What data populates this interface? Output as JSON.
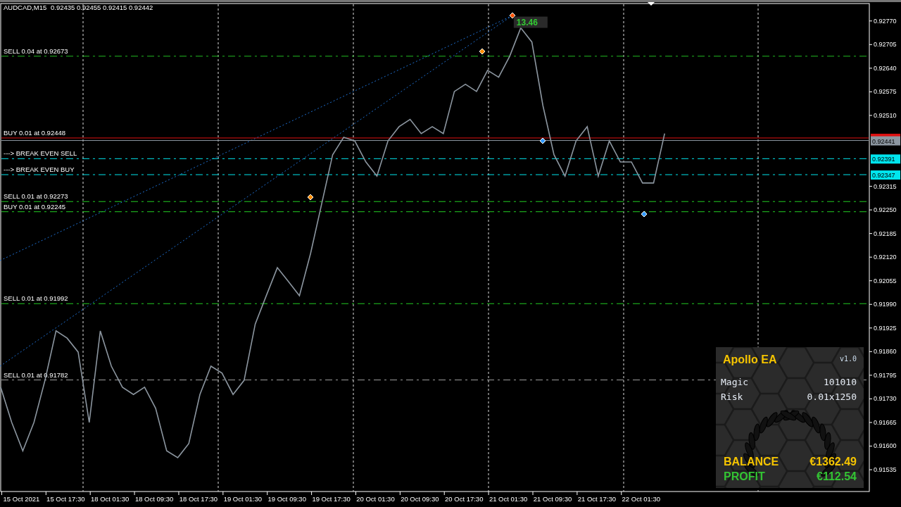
{
  "chart": {
    "quote": "0.92435 0.92455 0.92415 0.92442",
    "chart_data": {
      "type": "line",
      "title": "AUDCAD,M15",
      "grid": true,
      "categories": [
        null,
        null,
        "15 Oct 2021",
        null,
        null,
        null,
        "15 Oct 17:30",
        null,
        null,
        null,
        "18 Oct 01:30",
        null,
        null,
        null,
        "18 Oct 09:30",
        null,
        null,
        null,
        "18 Oct 17:30",
        null,
        null,
        null,
        "19 Oct 01:30",
        null,
        null,
        null,
        "19 Oct 09:30",
        null,
        null,
        null,
        "19 Oct 17:30",
        null,
        null,
        null,
        "20 Oct 01:30",
        null,
        null,
        null,
        "20 Oct 09:30",
        null,
        null,
        null,
        "20 Oct 17:30",
        null,
        null,
        null,
        "21 Oct 01:30",
        null,
        null,
        null,
        "21 Oct 09:30",
        null,
        null,
        null,
        "21 Oct 17:30",
        null,
        null,
        null,
        "22 Oct 01:30",
        null,
        null,
        null,
        null,
        null,
        null,
        null,
        null,
        null,
        null,
        null,
        null,
        null,
        null,
        null,
        null,
        null,
        null,
        null,
        null
      ],
      "series": [
        {
          "color": "#8c96a0",
          "values": [
            0.91762,
            0.91665,
            0.91587,
            0.91665,
            0.91781,
            0.91917,
            0.91897,
            0.91859,
            0.91665,
            0.91917,
            0.9182,
            0.91762,
            0.91742,
            0.91762,
            0.91704,
            0.91587,
            0.91568,
            0.91607,
            0.91742,
            0.9182,
            0.91801,
            0.91742,
            0.91781,
            0.91936,
            0.92014,
            0.92091,
            0.92053,
            0.92014,
            0.9213,
            0.92266,
            0.92402,
            0.9245,
            0.9244,
            0.92382,
            0.92343,
            0.9244,
            0.92479,
            0.92499,
            0.9246,
            0.92479,
            0.9246,
            0.92576,
            0.92596,
            0.92576,
            0.92634,
            0.92615,
            0.92673,
            0.92751,
            0.92712,
            0.92537,
            0.92402,
            0.92343,
            0.9244,
            0.92479,
            0.92343,
            0.9244,
            0.92382,
            0.92382,
            0.92324,
            0.92324,
            0.9246,
            null,
            null,
            null,
            null,
            null,
            null,
            null,
            null,
            null,
            null,
            null,
            null,
            null,
            null,
            null,
            null,
            null,
            null
          ]
        }
      ],
      "ylim": [
        0.91475,
        0.92818
      ],
      "yticks": [
        {
          "value": 0.9277,
          "label": "0.92770"
        },
        {
          "value": 0.92705,
          "label": "0.92705"
        },
        {
          "value": 0.9264,
          "label": "0.92640"
        },
        {
          "value": 0.92575,
          "label": "0.92575"
        },
        {
          "value": 0.9251,
          "label": "0.92510"
        },
        {
          "value": 0.92315,
          "label": "0.92315"
        },
        {
          "value": 0.9225,
          "label": "0.92250"
        },
        {
          "value": 0.92185,
          "label": "0.92185"
        },
        {
          "value": 0.9212,
          "label": "0.92120"
        },
        {
          "value": 0.92055,
          "label": "0.92055"
        },
        {
          "value": 0.9199,
          "label": "0.91990"
        },
        {
          "value": 0.91925,
          "label": "0.91925"
        },
        {
          "value": 0.9186,
          "label": "0.91860"
        },
        {
          "value": 0.91795,
          "label": "0.91795"
        },
        {
          "value": 0.9173,
          "label": "0.91730"
        },
        {
          "value": 0.91665,
          "label": "0.91665"
        },
        {
          "value": 0.916,
          "label": "0.91600"
        },
        {
          "value": 0.91535,
          "label": "0.91535"
        }
      ],
      "ref_lines": [
        {
          "axis": "y",
          "value": 0.92673,
          "label": "SELL 0.04 at 0.92673",
          "color": "#22bb22"
        },
        {
          "axis": "y",
          "value": 0.92448,
          "label": "BUY 0.01 at 0.92448",
          "color": "#dd1111"
        },
        {
          "axis": "y",
          "value": 0.92441,
          "color": "#8c96a0"
        },
        {
          "axis": "y",
          "value": 0.92391,
          "label": "---> BREAK EVEN SELL",
          "color": "#00e5ee"
        },
        {
          "axis": "y",
          "value": 0.92347,
          "label": "---> BREAK EVEN BUY",
          "color": "#00e5ee"
        },
        {
          "axis": "y",
          "value": 0.92273,
          "label": "SELL 0.01 at 0.92273",
          "color": "#22cc22"
        },
        {
          "axis": "y",
          "value": 0.92245,
          "label": "BUY 0.01 at 0.92245",
          "color": "#22cc22"
        },
        {
          "axis": "y",
          "value": 0.91992,
          "label": "SELL 0.01 at 0.91992",
          "color": "#22cc22"
        },
        {
          "axis": "y",
          "value": 0.91782,
          "label": "SELL 0.01 at 0.91782",
          "color": "#a0a0a0"
        }
      ],
      "annotations": [
        {
          "text": "13.46"
        }
      ]
    }
  },
  "price_tags": [
    {
      "text": "0.92441",
      "color": "#8c96a0"
    },
    {
      "text": "0.92391",
      "color": "#00e5ee"
    },
    {
      "text": "0.92347",
      "color": "#00e5ee"
    }
  ],
  "panel": {
    "title": "Apollo EA",
    "version": "v1.0",
    "rows": [
      {
        "label": "Magic",
        "value": "101010"
      },
      {
        "label": "Risk",
        "value": "0.01x1250"
      }
    ],
    "totals": [
      {
        "label": "BALANCE",
        "value": "€1362.49",
        "color": "#f5c400"
      },
      {
        "label": "PROFIT",
        "value": "€112.54",
        "color": "#33c433"
      }
    ]
  }
}
